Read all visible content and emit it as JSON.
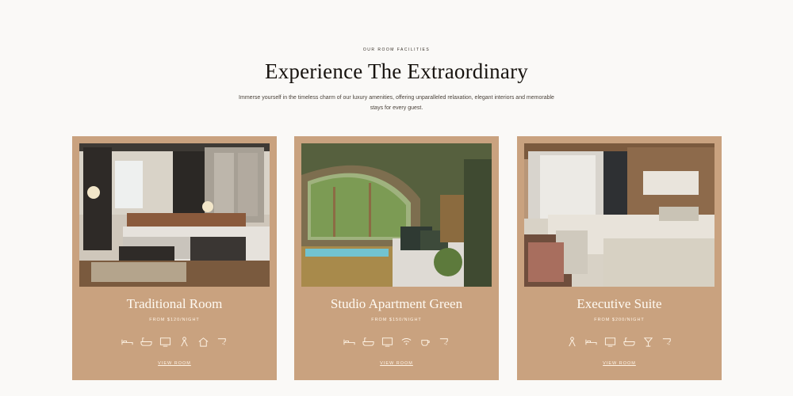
{
  "section": {
    "eyebrow": "OUR ROOM FACILITIES",
    "title": "Experience The Extraordinary",
    "description": "Immerse yourself in the timeless charm of our luxury amenities, offering unparalleled relaxation, elegant interiors and memorable stays for every guest."
  },
  "rooms": [
    {
      "name": "Traditional Room",
      "rate": "FROM $120/NIGHT",
      "amenities": [
        "bed-icon",
        "bath-icon",
        "tv-icon",
        "person-icon",
        "home-icon",
        "shower-icon"
      ],
      "link_label": "VIEW ROOM"
    },
    {
      "name": "Studio Apartment Green",
      "rate": "FROM $150/NIGHT",
      "amenities": [
        "bed-icon",
        "bath-icon",
        "tv-icon",
        "wifi-icon",
        "coffee-icon",
        "shower-icon"
      ],
      "link_label": "VIEW ROOM"
    },
    {
      "name": "Executive Suite",
      "rate": "FROM $200/NIGHT",
      "amenities": [
        "person-icon",
        "bed-icon",
        "tv-icon",
        "bath-icon",
        "cocktail-icon",
        "shower-icon"
      ],
      "link_label": "VIEW ROOM"
    }
  ],
  "colors": {
    "card": "#c9a27f",
    "background": "#faf9f7",
    "text_light": "#fffaf2"
  }
}
